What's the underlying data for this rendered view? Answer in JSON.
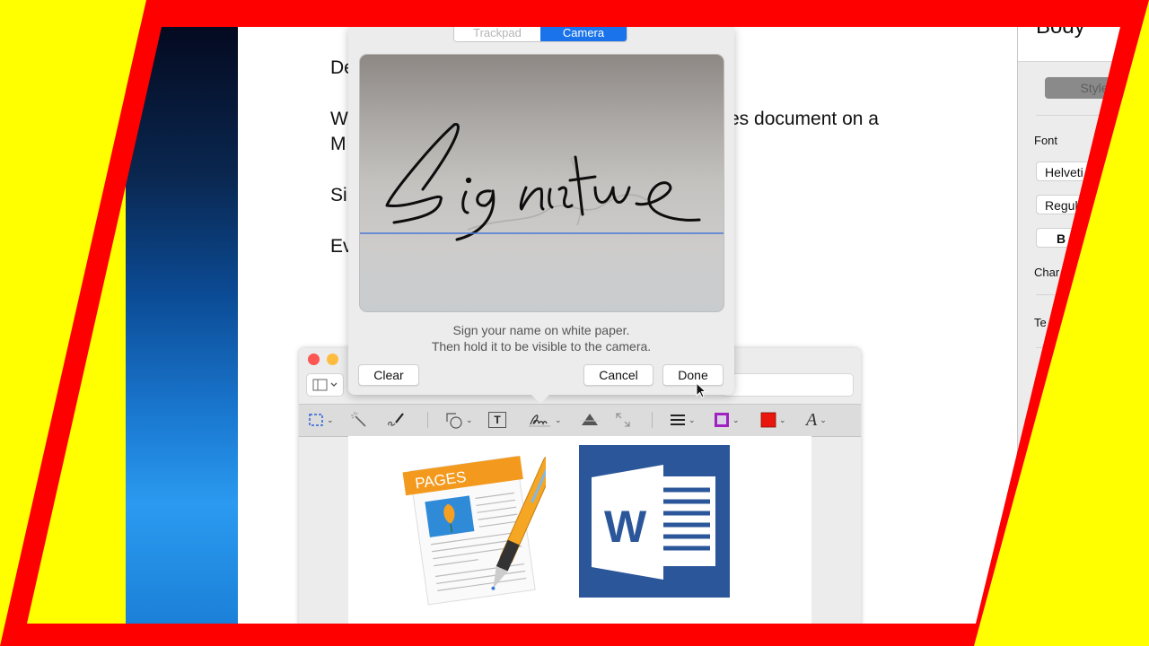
{
  "document": {
    "lines": [
      "De",
      "W",
      "es document on a",
      "M",
      "Si",
      "Ev"
    ]
  },
  "inspector": {
    "title": "Body",
    "style_button": "Style",
    "font_label": "Font",
    "font_family": "Helveti",
    "font_weight": "Regul",
    "bold_button": "B",
    "char_label": "Char",
    "text_label": "Te"
  },
  "signature_popover": {
    "tabs": [
      {
        "label": "Trackpad",
        "selected": false
      },
      {
        "label": "Camera",
        "selected": true
      }
    ],
    "preview_signature_text": "Signature",
    "hint_line1": "Sign your name on white paper.",
    "hint_line2": "Then hold it to be visible to the camera.",
    "clear_button": "Clear",
    "cancel_button": "Cancel",
    "done_button": "Done"
  },
  "preview_window": {
    "markup_tools": [
      {
        "name": "rectangular-selection",
        "has_menu": true
      },
      {
        "name": "instant-alpha",
        "has_menu": false
      },
      {
        "name": "sketch",
        "has_menu": false
      },
      {
        "name": "shapes",
        "has_menu": true
      },
      {
        "name": "text",
        "has_menu": false
      },
      {
        "name": "sign",
        "has_menu": true
      },
      {
        "name": "adjust-color",
        "has_menu": false
      },
      {
        "name": "adjust-size",
        "has_menu": false
      },
      {
        "name": "shape-style",
        "has_menu": true
      },
      {
        "name": "border-color",
        "has_menu": true
      },
      {
        "name": "fill-color",
        "has_menu": true
      },
      {
        "name": "text-style",
        "has_menu": true
      }
    ],
    "text_style_glyph": "A",
    "text_tool_glyph": "T",
    "colors": {
      "border_color": "#a020c0",
      "fill_color": "#e8160c",
      "selection_accent": "#2a62d8"
    },
    "page_images": [
      {
        "name": "pages-app-icon",
        "label": "PAGES"
      },
      {
        "name": "word-app-icon",
        "label": "W"
      }
    ]
  },
  "thumbnail_frame": {
    "border_color": "#ff0000",
    "background_color": "#ffff00"
  }
}
